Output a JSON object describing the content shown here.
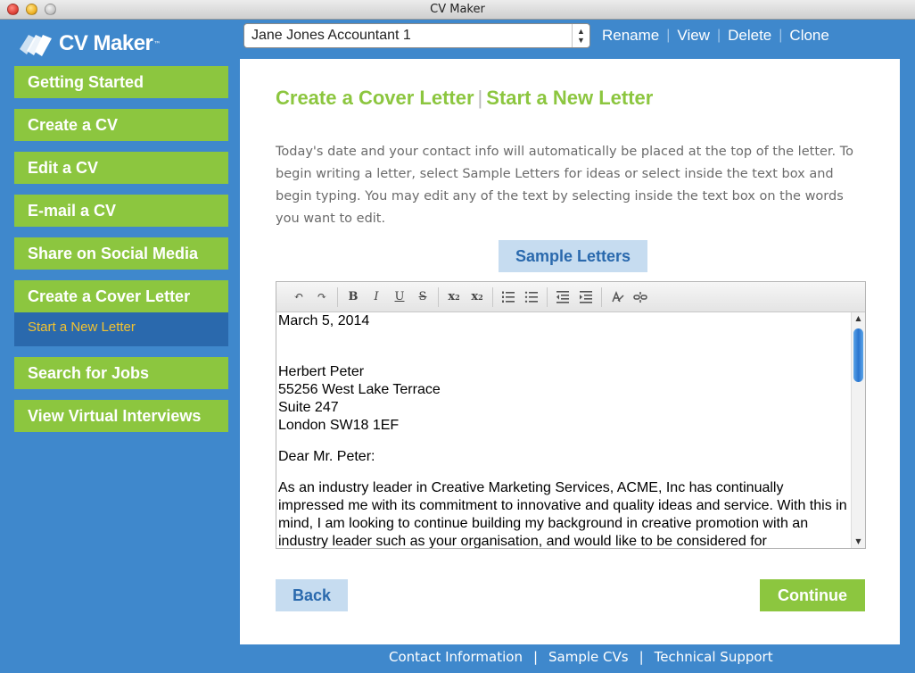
{
  "window": {
    "title": "CV Maker"
  },
  "logo": {
    "text": "CV Maker",
    "tm": "™"
  },
  "nav": {
    "items": [
      {
        "label": "Getting Started"
      },
      {
        "label": "Create a CV"
      },
      {
        "label": "Edit a CV"
      },
      {
        "label": "E-mail a CV"
      },
      {
        "label": "Share on Social Media"
      },
      {
        "label": "Create a Cover Letter"
      },
      {
        "label": "Search for Jobs"
      },
      {
        "label": "View Virtual Interviews"
      }
    ],
    "sub_active": "Start a New Letter"
  },
  "topbar": {
    "selected_document": "Jane Jones Accountant 1",
    "rename": "Rename",
    "view": "View",
    "delete": "Delete",
    "clone": "Clone",
    "separator": "|"
  },
  "content": {
    "heading_primary": "Create a Cover Letter",
    "heading_separator": "|",
    "heading_secondary": "Start a New Letter",
    "intro": "Today's date and your contact info will automatically be placed at the top of the letter. To begin writing a letter, select Sample Letters for ideas or select inside the text box and begin typing. You may edit any of the text by selecting inside the text box on the words you want to edit.",
    "sample_letters_label": "Sample Letters",
    "letter": {
      "date": "March 5, 2014",
      "recipient_name": "Herbert Peter",
      "address_line1": "55256 West Lake Terrace",
      "address_line2": "Suite 247",
      "address_line3": "London SW18 1EF",
      "salutation": "Dear Mr. Peter:",
      "body": "As an industry leader in Creative Marketing Services, ACME, Inc has continually impressed me with its commitment to innovative and quality ideas and service. With this in mind, I am looking to continue building my background in creative promotion with an industry leader such as your organisation, and would like to be considered for"
    },
    "back_label": "Back",
    "continue_label": "Continue"
  },
  "footer": {
    "contact": "Contact Information",
    "samples": "Sample CVs",
    "support": "Technical Support",
    "separator": "|"
  }
}
